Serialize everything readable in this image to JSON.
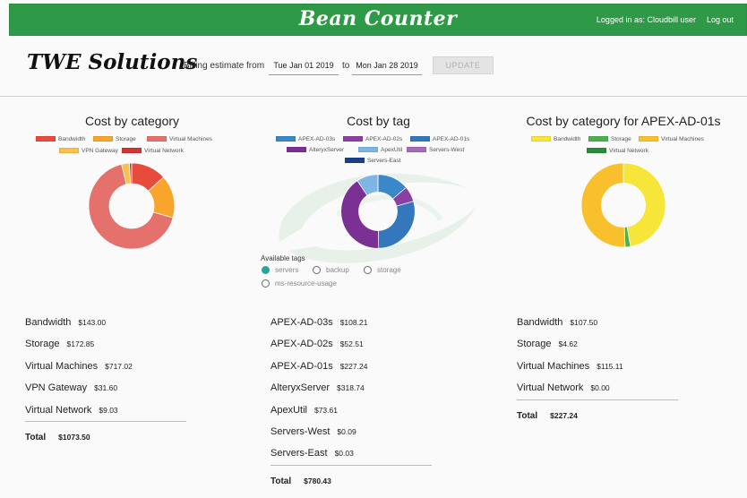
{
  "header": {
    "brand": "Bean Counter",
    "logged_in": "Logged in as: Cloudbill user",
    "logout": "Log out",
    "brand_color": "#2e9a47"
  },
  "billing": {
    "company": "TWE Solutions",
    "label": "Billing estimate from",
    "start_date": "Tue Jan 01 2019",
    "to_label": "to",
    "end_date": "Mon Jan 28 2019",
    "update_label": "UPDATE"
  },
  "tags": {
    "title": "Available tags",
    "options": [
      {
        "label": "servers",
        "selected": true
      },
      {
        "label": "backup",
        "selected": false
      },
      {
        "label": "storage",
        "selected": false
      },
      {
        "label": "ms-resource-usage",
        "selected": false
      }
    ]
  },
  "chart_data": [
    {
      "type": "pie",
      "title": "Cost by category",
      "categories": [
        "Bandwidth",
        "Storage",
        "Virtual Machines",
        "VPN Gateway",
        "Virtual Network"
      ],
      "values": [
        143.0,
        172.85,
        717.02,
        31.6,
        9.03
      ],
      "colors": [
        "#e84a3c",
        "#f9a42a",
        "#e5716c",
        "#fbbf4e",
        "#d3322f"
      ],
      "legend": "top"
    },
    {
      "type": "pie",
      "title": "Cost by tag",
      "categories": [
        "APEX-AD-03s",
        "APEX-AD-02s",
        "APEX-AD-01s",
        "AlteryxServer",
        "ApexUtil",
        "Servers-West",
        "Servers-East"
      ],
      "values": [
        108.21,
        52.51,
        227.24,
        318.74,
        73.61,
        0.09,
        0.03
      ],
      "colors": [
        "#3a87c9",
        "#8b3fa3",
        "#3577bd",
        "#7b3194",
        "#7fb5e3",
        "#a569bd",
        "#1d3f8a"
      ],
      "legend": "top"
    },
    {
      "type": "pie",
      "title": "Cost by category for APEX-AD-01s",
      "categories": [
        "Bandwidth",
        "Storage",
        "Virtual Machines",
        "Virtual Network"
      ],
      "values": [
        107.5,
        4.62,
        115.11,
        0.0
      ],
      "colors": [
        "#f7e53a",
        "#4caf50",
        "#f9c02e",
        "#2e8b3e"
      ],
      "legend": "top"
    }
  ],
  "lists": [
    {
      "rows": [
        {
          "name": "Bandwidth",
          "value": "$143.00"
        },
        {
          "name": "Storage",
          "value": "$172.85"
        },
        {
          "name": "Virtual Machines",
          "value": "$717.02"
        },
        {
          "name": "VPN Gateway",
          "value": "$31.60"
        },
        {
          "name": "Virtual Network",
          "value": "$9.03"
        }
      ],
      "total_label": "Total",
      "total_value": "$1073.50"
    },
    {
      "rows": [
        {
          "name": "APEX-AD-03s",
          "value": "$108.21"
        },
        {
          "name": "APEX-AD-02s",
          "value": "$52.51"
        },
        {
          "name": "APEX-AD-01s",
          "value": "$227.24"
        },
        {
          "name": "AlteryxServer",
          "value": "$318.74"
        },
        {
          "name": "ApexUtil",
          "value": "$73.61"
        },
        {
          "name": "Servers-West",
          "value": "$0.09"
        },
        {
          "name": "Servers-East",
          "value": "$0.03"
        }
      ],
      "total_label": "Total",
      "total_value": "$780.43"
    },
    {
      "rows": [
        {
          "name": "Bandwidth",
          "value": "$107.50"
        },
        {
          "name": "Storage",
          "value": "$4.62"
        },
        {
          "name": "Virtual Machines",
          "value": "$115.11"
        },
        {
          "name": "Virtual Network",
          "value": "$0.00"
        }
      ],
      "total_label": "Total",
      "total_value": "$227.24"
    }
  ]
}
